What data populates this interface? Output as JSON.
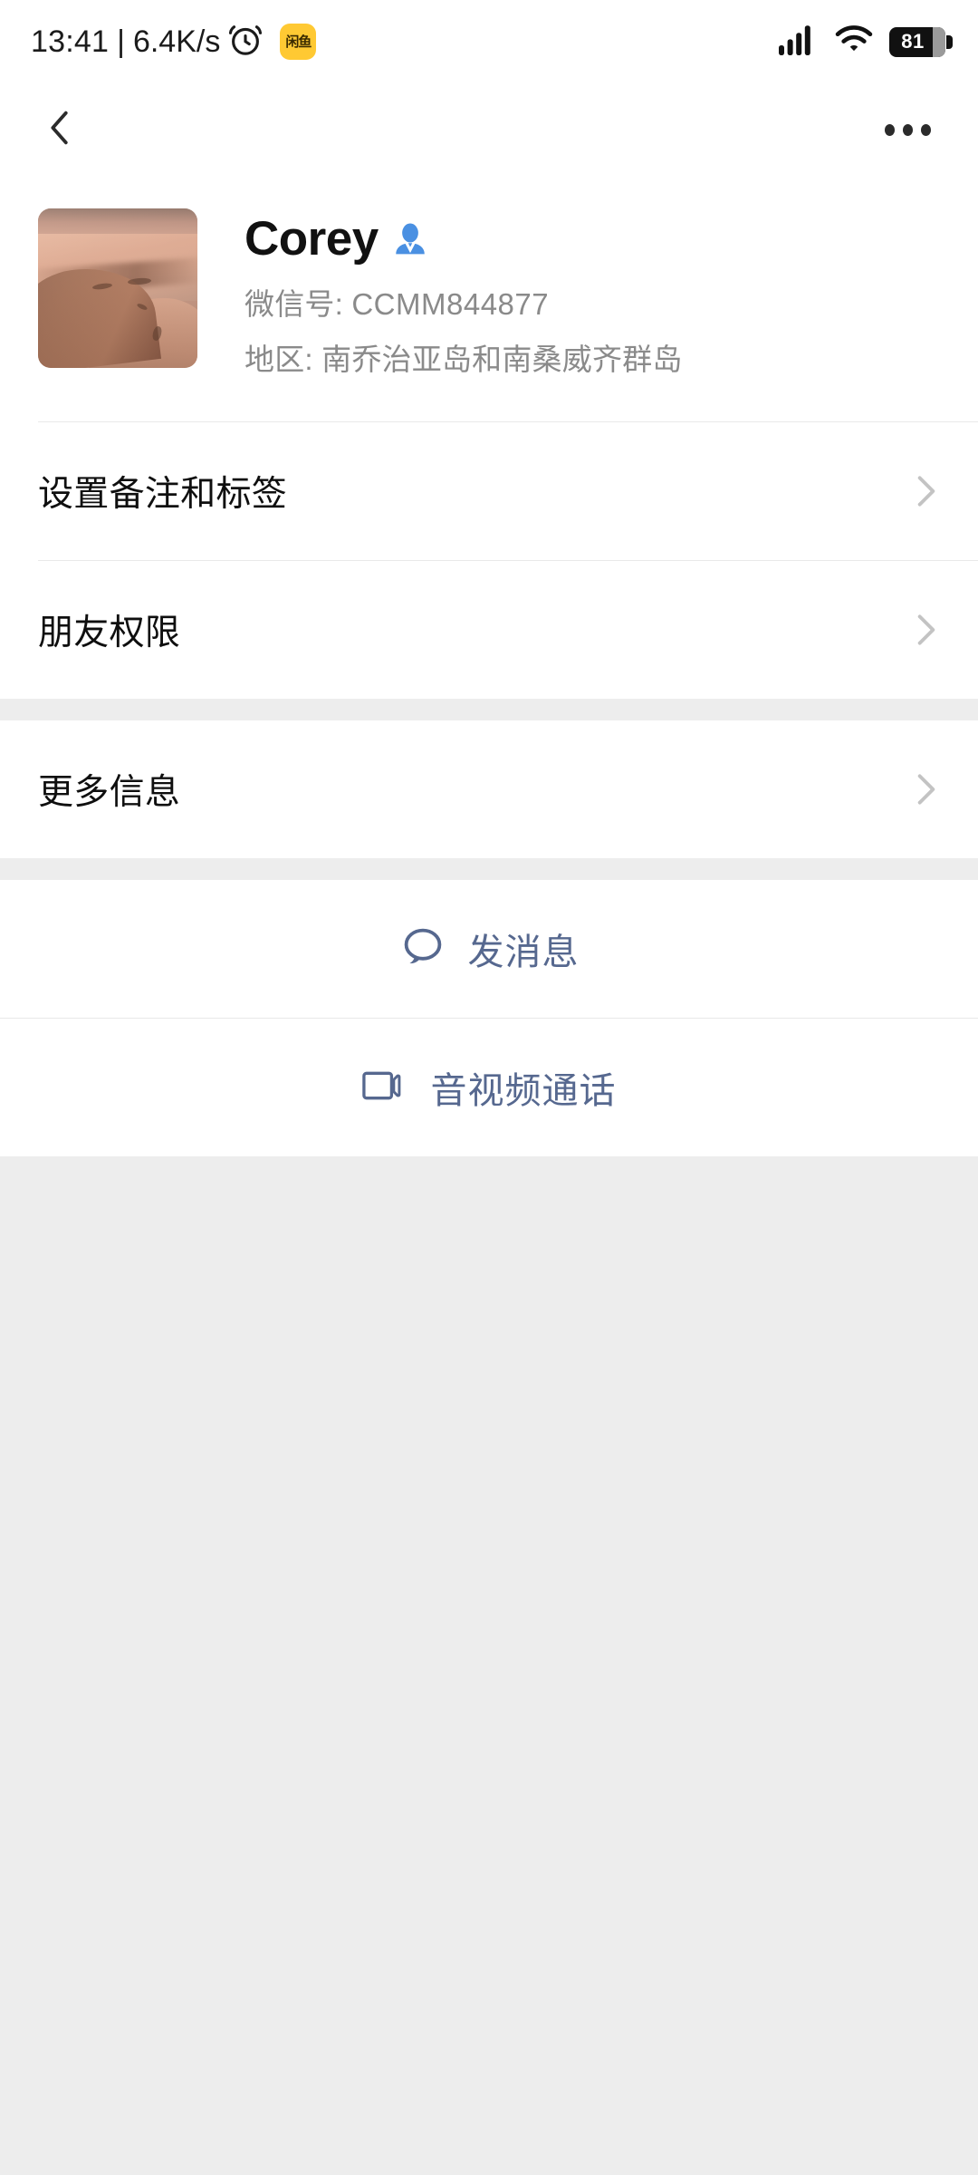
{
  "status_bar": {
    "time": "13:41",
    "separator": "|",
    "network_speed": "6.4K/s",
    "alarm_icon": "alarm-clock-icon",
    "app_badge": "闲鱼",
    "signal_icon": "cellular-signal-icon",
    "wifi_icon": "wifi-icon",
    "battery_level": "81"
  },
  "nav": {
    "back_icon": "chevron-left-icon",
    "more_icon": "more-horizontal-icon"
  },
  "profile": {
    "avatar_alt": "desert-dunes-photo",
    "name": "Corey",
    "gender_icon": "male-person-icon",
    "wechat_id_label": "微信号:",
    "wechat_id_value": "CCMM844877",
    "region_label": "地区:",
    "region_value": "南乔治亚岛和南桑威齐群岛"
  },
  "list_group_1": [
    {
      "label": "设置备注和标签",
      "chevron": "chevron-right-icon"
    },
    {
      "label": "朋友权限",
      "chevron": "chevron-right-icon"
    }
  ],
  "list_group_2": [
    {
      "label": "更多信息",
      "chevron": "chevron-right-icon"
    }
  ],
  "actions": [
    {
      "label": "发消息",
      "icon": "chat-bubble-icon"
    },
    {
      "label": "音视频通话",
      "icon": "video-camera-icon"
    }
  ],
  "colors": {
    "accent_blue": "#56688f",
    "link_blue": "#4a90e2",
    "page_bg": "#ededed",
    "card_bg": "#ffffff",
    "divider": "#e9e9e9",
    "text_primary": "#111111",
    "text_secondary": "#8a8a8a",
    "chevron": "#c3c3c3",
    "badge_yellow": "#ffc933"
  }
}
